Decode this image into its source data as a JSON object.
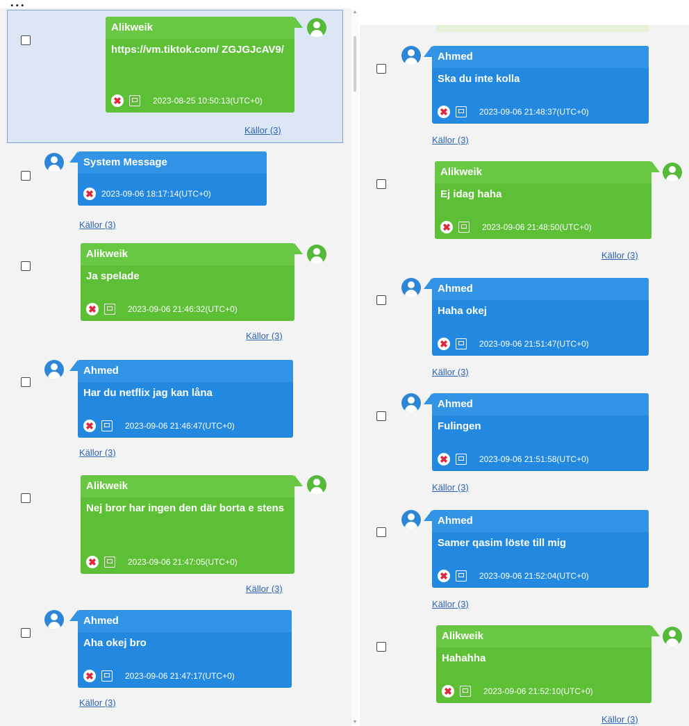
{
  "colors": {
    "blue_bubble": "#2389e0",
    "green_bubble": "#5cbf35",
    "link": "#2a62b4",
    "panel_bg": "#f3f3f3",
    "selection": "#dde6f5"
  },
  "header_fragment": "...",
  "messages_left": [
    {
      "sender": "Alikweik",
      "text": "https://vm.tiktok.com/ ZGJGJcAV9/",
      "timestamp": "2023-08-25 10:50:13(UTC+0)",
      "sources": "Källor (3)",
      "side": "right"
    },
    {
      "sender": "System Message",
      "text": "",
      "timestamp": "2023-09-06 18:17:14(UTC+0)",
      "sources": "Källor (3)",
      "side": "left"
    },
    {
      "sender": "Alikweik",
      "text": "Ja spelade",
      "timestamp": "2023-09-06 21:46:32(UTC+0)",
      "sources": "Källor (3)",
      "side": "right"
    },
    {
      "sender": "Ahmed",
      "text": "Har du netflix jag kan låna",
      "timestamp": "2023-09-06 21:46:47(UTC+0)",
      "sources": "Källor (3)",
      "side": "left"
    },
    {
      "sender": "Alikweik",
      "text": "Nej bror har ingen den där borta e stens",
      "timestamp": "2023-09-06 21:47:05(UTC+0)",
      "sources": "Källor (3)",
      "side": "right"
    },
    {
      "sender": "Ahmed",
      "text": "Aha okej bro",
      "timestamp": "2023-09-06 21:47:17(UTC+0)",
      "sources": "Källor (3)",
      "side": "left"
    }
  ],
  "messages_right": [
    {
      "sender": "Ahmed",
      "text": "Ska du inte kolla",
      "timestamp": "2023-09-06 21:48:37(UTC+0)",
      "sources": "Källor (3)",
      "side": "left"
    },
    {
      "sender": "Alikweik",
      "text": "Ej idag haha",
      "timestamp": "2023-09-06 21:48:50(UTC+0)",
      "sources": "Källor (3)",
      "side": "right"
    },
    {
      "sender": "Ahmed",
      "text": "Haha okej",
      "timestamp": "2023-09-06 21:51:47(UTC+0)",
      "sources": "Källor (3)",
      "side": "left"
    },
    {
      "sender": "Ahmed",
      "text": "Fulingen",
      "timestamp": "2023-09-06 21:51:58(UTC+0)",
      "sources": "Källor (3)",
      "side": "left"
    },
    {
      "sender": "Ahmed",
      "text": "Samer qasim löste till mig",
      "timestamp": "2023-09-06 21:52:04(UTC+0)",
      "sources": "Källor (3)",
      "side": "left"
    },
    {
      "sender": "Alikweik",
      "text": "Hahahha",
      "timestamp": "2023-09-06 21:52:10(UTC+0)",
      "sources": "Källor (3)",
      "side": "right"
    }
  ],
  "icons": {
    "avatar": "user-avatar-icon",
    "delete": "delete-x-icon",
    "copy": "copy-icon",
    "checkbox": "select-checkbox"
  }
}
